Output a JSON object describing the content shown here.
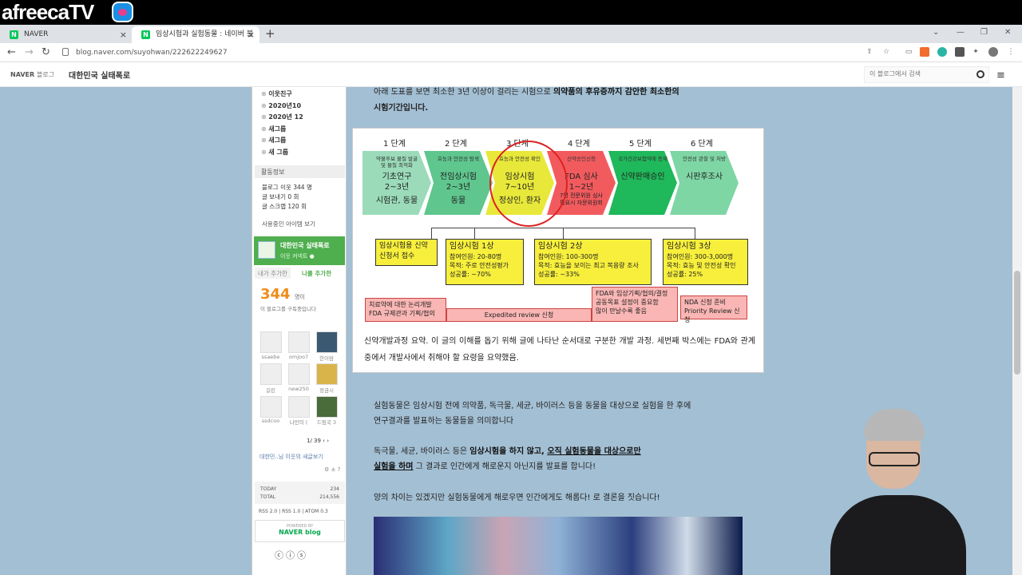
{
  "stream": {
    "logo": "afreecaTV"
  },
  "browser": {
    "tabs": [
      {
        "label": "NAVER",
        "favicon": "N"
      },
      {
        "label": "임상시험과 실험동물 : 네이버 블",
        "favicon": "N"
      }
    ],
    "url": "blog.naver.com/suyohwan/222622249627"
  },
  "blog": {
    "naver_label": "NAVER",
    "blog_label": "블로그",
    "title": "대한민국 실태폭로",
    "search_placeholder": "이 블로그에서 검색"
  },
  "sidebar": {
    "categories": [
      "이웃친구",
      "2020년10",
      "2020년 12",
      "새그룹",
      "새그룹",
      "새 그룹"
    ],
    "activity_title": "활동정보",
    "stats": [
      "블로그 이웃 344 명",
      "글 보내기 0 회",
      "글 스크랩 120 회"
    ],
    "apps_link": "사용중인 아이템 보기",
    "channel": {
      "name": "대한민국 실태폭로",
      "sub": "이웃 커넥트 ●"
    },
    "tab_added": "내가 추가한",
    "tab_me": "나를 추가한",
    "neighbor_count": "344",
    "neighbor_unit": "명이",
    "neighbor_desc": "이 블로그를 구독중입니다",
    "neighbors": [
      "ssaebe",
      "omjoo7",
      "한이맘",
      "길린",
      "new250",
      "정금시",
      "ssdcoo",
      "나만의 (",
      "드림국 3"
    ],
    "pager": "1/ 39",
    "footer_link": "대한민..님 이웃의 새글보기",
    "counter": {
      "today_label": "TODAY",
      "today": "234",
      "total_label": "TOTAL",
      "total": "214,556"
    },
    "rss": "RSS 2.0 | RSS 1.0 | ATOM 0.3",
    "powered": "POWERED BY",
    "powered_brand": "NAVER blog"
  },
  "post": {
    "intro_1a": "아래 도표를 보면 최소한 3년 이상이 걸리는 시험으로 ",
    "intro_1b": "의약품의 후유증까지 감안한 최소한의",
    "intro_2": "시험기간입니다.",
    "caption": "신약개발과정 요약. 이 글의 이해를 돕기 위해 글에 나타난 순서대로 구분한 개발 과정. 세번째 박스에는 FDA와 관계 중에서 개발사에서 취해야 할 요령을 요약했음.",
    "para1a": "실험동물은 임상시험 전에 의약품, 독극물, 세균, 바이러스 등을 동물을 대상으로 실험을 한 후에",
    "para1b": "연구결과를 발표하는 동물들을 의미합니다",
    "para2a_plain": "독극물, 세균, 바이러스 등은 ",
    "para2a_bold": "임상시험을 하지 않고, ",
    "para2a_under": "오직 실험동물을 대상으로만",
    "para2b_under": "실험을 하며",
    "para2b_plain": " 그 결과로 인간에게 해로운지 아닌지를 발표를 합니다!",
    "para3": "양의 차이는 있겠지만 실험동물에게 해로우면 인간에게도 해롭다! 로 결론을 짓습니다!"
  },
  "diagram": {
    "stages": [
      "1 단계",
      "2 단계",
      "3 단계",
      "4 단계",
      "5 단계",
      "6 단계"
    ],
    "chevrons": [
      {
        "small": "약물후보 물질 발굴\n및 물질 최적화",
        "big": "기초연구\n2~3년",
        "bottom": "시험관, 동물",
        "color": "#9bdbb9"
      },
      {
        "small": "효능과 안전성 탐색",
        "big": "전임상시험\n2~3년",
        "bottom": "동물",
        "color": "#5fc68e"
      },
      {
        "small": "효능과 안전성 확인",
        "big": "임상시험\n7~10년",
        "bottom": "정상인, 환자",
        "color": "#e8e83a"
      },
      {
        "small": "신약승인신청",
        "big": "FDA 심사\n1~2년",
        "bottom": "7명 전문위원 심사\n필요시 자문위원회",
        "color": "#f25b5e"
      },
      {
        "small": "국가건강보험약에 등재",
        "big": "신약판매승인",
        "bottom": "",
        "color": "#1fb85a"
      },
      {
        "small": "안전성 관찰 및 처방",
        "big": "시판후조사",
        "bottom": "",
        "color": "#7fd6a5"
      }
    ],
    "ind": {
      "title": "임상시험용 신약\n신청서 접수"
    },
    "phases": [
      {
        "title": "임상시험 1상",
        "lines": [
          "참여인원: 20-80명",
          "목적: 주로 안전성평가",
          "성공률: ~70%"
        ]
      },
      {
        "title": "임상시험 2상",
        "lines": [
          "참여인원: 100-300명",
          "목적: 효능을 보이는 최고 복용량 조사",
          "성공률: ~33%"
        ]
      },
      {
        "title": "임상시험 3상",
        "lines": [
          "참여인원: 300-3,000명",
          "목적: 효능 및 안전성 확인",
          "성공률: 25%"
        ]
      }
    ],
    "pink_left": "치료약에 대한 논리개발\nFDA 규제관과 기획/협의",
    "pink_mid": "Expedited review 신청",
    "pink_right": "FDA와 임상기획/협의/결정\n공동목표 설정이 중요함\n많이 만날수록 좋음",
    "pink_nda": "NDA 신청 준비\nPriority Review 신청"
  }
}
